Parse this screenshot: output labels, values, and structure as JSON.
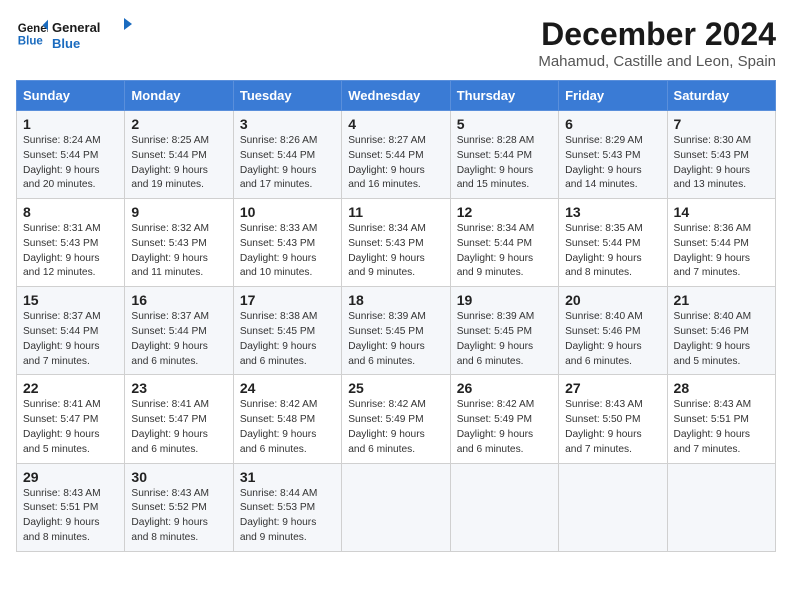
{
  "logo": {
    "line1": "General",
    "line2": "Blue"
  },
  "title": "December 2024",
  "subtitle": "Mahamud, Castille and Leon, Spain",
  "headers": [
    "Sunday",
    "Monday",
    "Tuesday",
    "Wednesday",
    "Thursday",
    "Friday",
    "Saturday"
  ],
  "weeks": [
    [
      {
        "day": "1",
        "lines": [
          "Sunrise: 8:24 AM",
          "Sunset: 5:44 PM",
          "Daylight: 9 hours",
          "and 20 minutes."
        ]
      },
      {
        "day": "2",
        "lines": [
          "Sunrise: 8:25 AM",
          "Sunset: 5:44 PM",
          "Daylight: 9 hours",
          "and 19 minutes."
        ]
      },
      {
        "day": "3",
        "lines": [
          "Sunrise: 8:26 AM",
          "Sunset: 5:44 PM",
          "Daylight: 9 hours",
          "and 17 minutes."
        ]
      },
      {
        "day": "4",
        "lines": [
          "Sunrise: 8:27 AM",
          "Sunset: 5:44 PM",
          "Daylight: 9 hours",
          "and 16 minutes."
        ]
      },
      {
        "day": "5",
        "lines": [
          "Sunrise: 8:28 AM",
          "Sunset: 5:44 PM",
          "Daylight: 9 hours",
          "and 15 minutes."
        ]
      },
      {
        "day": "6",
        "lines": [
          "Sunrise: 8:29 AM",
          "Sunset: 5:43 PM",
          "Daylight: 9 hours",
          "and 14 minutes."
        ]
      },
      {
        "day": "7",
        "lines": [
          "Sunrise: 8:30 AM",
          "Sunset: 5:43 PM",
          "Daylight: 9 hours",
          "and 13 minutes."
        ]
      }
    ],
    [
      {
        "day": "8",
        "lines": [
          "Sunrise: 8:31 AM",
          "Sunset: 5:43 PM",
          "Daylight: 9 hours",
          "and 12 minutes."
        ]
      },
      {
        "day": "9",
        "lines": [
          "Sunrise: 8:32 AM",
          "Sunset: 5:43 PM",
          "Daylight: 9 hours",
          "and 11 minutes."
        ]
      },
      {
        "day": "10",
        "lines": [
          "Sunrise: 8:33 AM",
          "Sunset: 5:43 PM",
          "Daylight: 9 hours",
          "and 10 minutes."
        ]
      },
      {
        "day": "11",
        "lines": [
          "Sunrise: 8:34 AM",
          "Sunset: 5:43 PM",
          "Daylight: 9 hours",
          "and 9 minutes."
        ]
      },
      {
        "day": "12",
        "lines": [
          "Sunrise: 8:34 AM",
          "Sunset: 5:44 PM",
          "Daylight: 9 hours",
          "and 9 minutes."
        ]
      },
      {
        "day": "13",
        "lines": [
          "Sunrise: 8:35 AM",
          "Sunset: 5:44 PM",
          "Daylight: 9 hours",
          "and 8 minutes."
        ]
      },
      {
        "day": "14",
        "lines": [
          "Sunrise: 8:36 AM",
          "Sunset: 5:44 PM",
          "Daylight: 9 hours",
          "and 7 minutes."
        ]
      }
    ],
    [
      {
        "day": "15",
        "lines": [
          "Sunrise: 8:37 AM",
          "Sunset: 5:44 PM",
          "Daylight: 9 hours",
          "and 7 minutes."
        ]
      },
      {
        "day": "16",
        "lines": [
          "Sunrise: 8:37 AM",
          "Sunset: 5:44 PM",
          "Daylight: 9 hours",
          "and 6 minutes."
        ]
      },
      {
        "day": "17",
        "lines": [
          "Sunrise: 8:38 AM",
          "Sunset: 5:45 PM",
          "Daylight: 9 hours",
          "and 6 minutes."
        ]
      },
      {
        "day": "18",
        "lines": [
          "Sunrise: 8:39 AM",
          "Sunset: 5:45 PM",
          "Daylight: 9 hours",
          "and 6 minutes."
        ]
      },
      {
        "day": "19",
        "lines": [
          "Sunrise: 8:39 AM",
          "Sunset: 5:45 PM",
          "Daylight: 9 hours",
          "and 6 minutes."
        ]
      },
      {
        "day": "20",
        "lines": [
          "Sunrise: 8:40 AM",
          "Sunset: 5:46 PM",
          "Daylight: 9 hours",
          "and 6 minutes."
        ]
      },
      {
        "day": "21",
        "lines": [
          "Sunrise: 8:40 AM",
          "Sunset: 5:46 PM",
          "Daylight: 9 hours",
          "and 5 minutes."
        ]
      }
    ],
    [
      {
        "day": "22",
        "lines": [
          "Sunrise: 8:41 AM",
          "Sunset: 5:47 PM",
          "Daylight: 9 hours",
          "and 5 minutes."
        ]
      },
      {
        "day": "23",
        "lines": [
          "Sunrise: 8:41 AM",
          "Sunset: 5:47 PM",
          "Daylight: 9 hours",
          "and 6 minutes."
        ]
      },
      {
        "day": "24",
        "lines": [
          "Sunrise: 8:42 AM",
          "Sunset: 5:48 PM",
          "Daylight: 9 hours",
          "and 6 minutes."
        ]
      },
      {
        "day": "25",
        "lines": [
          "Sunrise: 8:42 AM",
          "Sunset: 5:49 PM",
          "Daylight: 9 hours",
          "and 6 minutes."
        ]
      },
      {
        "day": "26",
        "lines": [
          "Sunrise: 8:42 AM",
          "Sunset: 5:49 PM",
          "Daylight: 9 hours",
          "and 6 minutes."
        ]
      },
      {
        "day": "27",
        "lines": [
          "Sunrise: 8:43 AM",
          "Sunset: 5:50 PM",
          "Daylight: 9 hours",
          "and 7 minutes."
        ]
      },
      {
        "day": "28",
        "lines": [
          "Sunrise: 8:43 AM",
          "Sunset: 5:51 PM",
          "Daylight: 9 hours",
          "and 7 minutes."
        ]
      }
    ],
    [
      {
        "day": "29",
        "lines": [
          "Sunrise: 8:43 AM",
          "Sunset: 5:51 PM",
          "Daylight: 9 hours",
          "and 8 minutes."
        ]
      },
      {
        "day": "30",
        "lines": [
          "Sunrise: 8:43 AM",
          "Sunset: 5:52 PM",
          "Daylight: 9 hours",
          "and 8 minutes."
        ]
      },
      {
        "day": "31",
        "lines": [
          "Sunrise: 8:44 AM",
          "Sunset: 5:53 PM",
          "Daylight: 9 hours",
          "and 9 minutes."
        ]
      },
      null,
      null,
      null,
      null
    ]
  ]
}
